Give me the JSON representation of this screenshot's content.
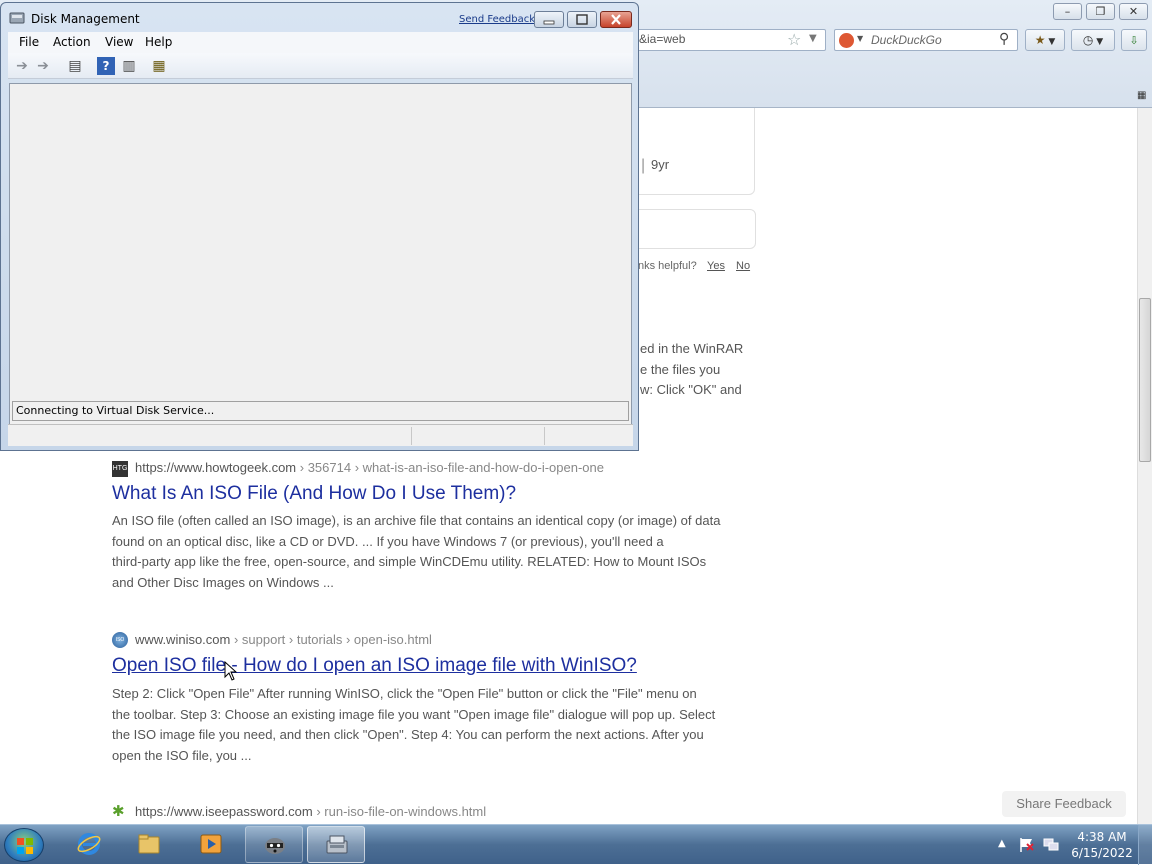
{
  "browser": {
    "url_fragment": "&ia=web",
    "search_engine": "DuckDuckGo"
  },
  "page": {
    "partial_card": {
      "age": "9yr",
      "helpful_text": "nks helpful?",
      "yes": "Yes",
      "no": "No",
      "snippet_lines": [
        "ed in the WinRAR",
        "e the files you",
        "w: Click \"OK\" and"
      ]
    },
    "results": [
      {
        "domain": "https://www.howtogeek.com",
        "path": "› 356714 › what-is-an-iso-file-and-how-do-i-open-one",
        "favicon_text": "HTG",
        "title": "What Is An ISO File (And How Do I Use Them)?",
        "snippet_lines": [
          "An ISO file (often called an ISO image), is an archive file that contains an identical copy (or image) of data",
          "found on an optical disc, like a CD or DVD. ... If you have Windows 7 (or previous), you'll need a",
          "third-party app like the free, open-source, and simple WinCDEmu utility. RELATED: How to Mount ISOs",
          "and Other Disc Images on Windows ..."
        ]
      },
      {
        "domain": "www.winiso.com",
        "path": "› support › tutorials › open-iso.html",
        "favicon_text": "ISO",
        "title": "Open ISO file - How do I open an ISO image file with WinISO?",
        "snippet_lines": [
          "Step 2: Click \"Open File\" After running WinISO, click the \"Open File\" button or click the \"File\" menu on",
          "the toolbar. Step 3: Choose an existing image file you want \"Open image file\" dialogue will pop up. Select",
          "the ISO image file you need, and then click \"Open\". Step 4: You can perform the next actions. After you",
          "open the ISO file, you ..."
        ]
      },
      {
        "domain": "https://www.iseepassword.com",
        "path": "› run-iso-file-on-windows.html"
      }
    ],
    "share_feedback": "Share Feedback"
  },
  "disk_management": {
    "title": "Disk Management",
    "send_feedback": "Send Feedback",
    "menu": [
      "File",
      "Action",
      "View",
      "Help"
    ],
    "status": "Connecting to Virtual Disk Service..."
  },
  "taskbar": {
    "time": "4:38 AM",
    "date": "6/15/2022"
  },
  "colors": {
    "link": "#1d2f9f",
    "snippet": "#555555",
    "taskbar": "#4d6f95"
  }
}
